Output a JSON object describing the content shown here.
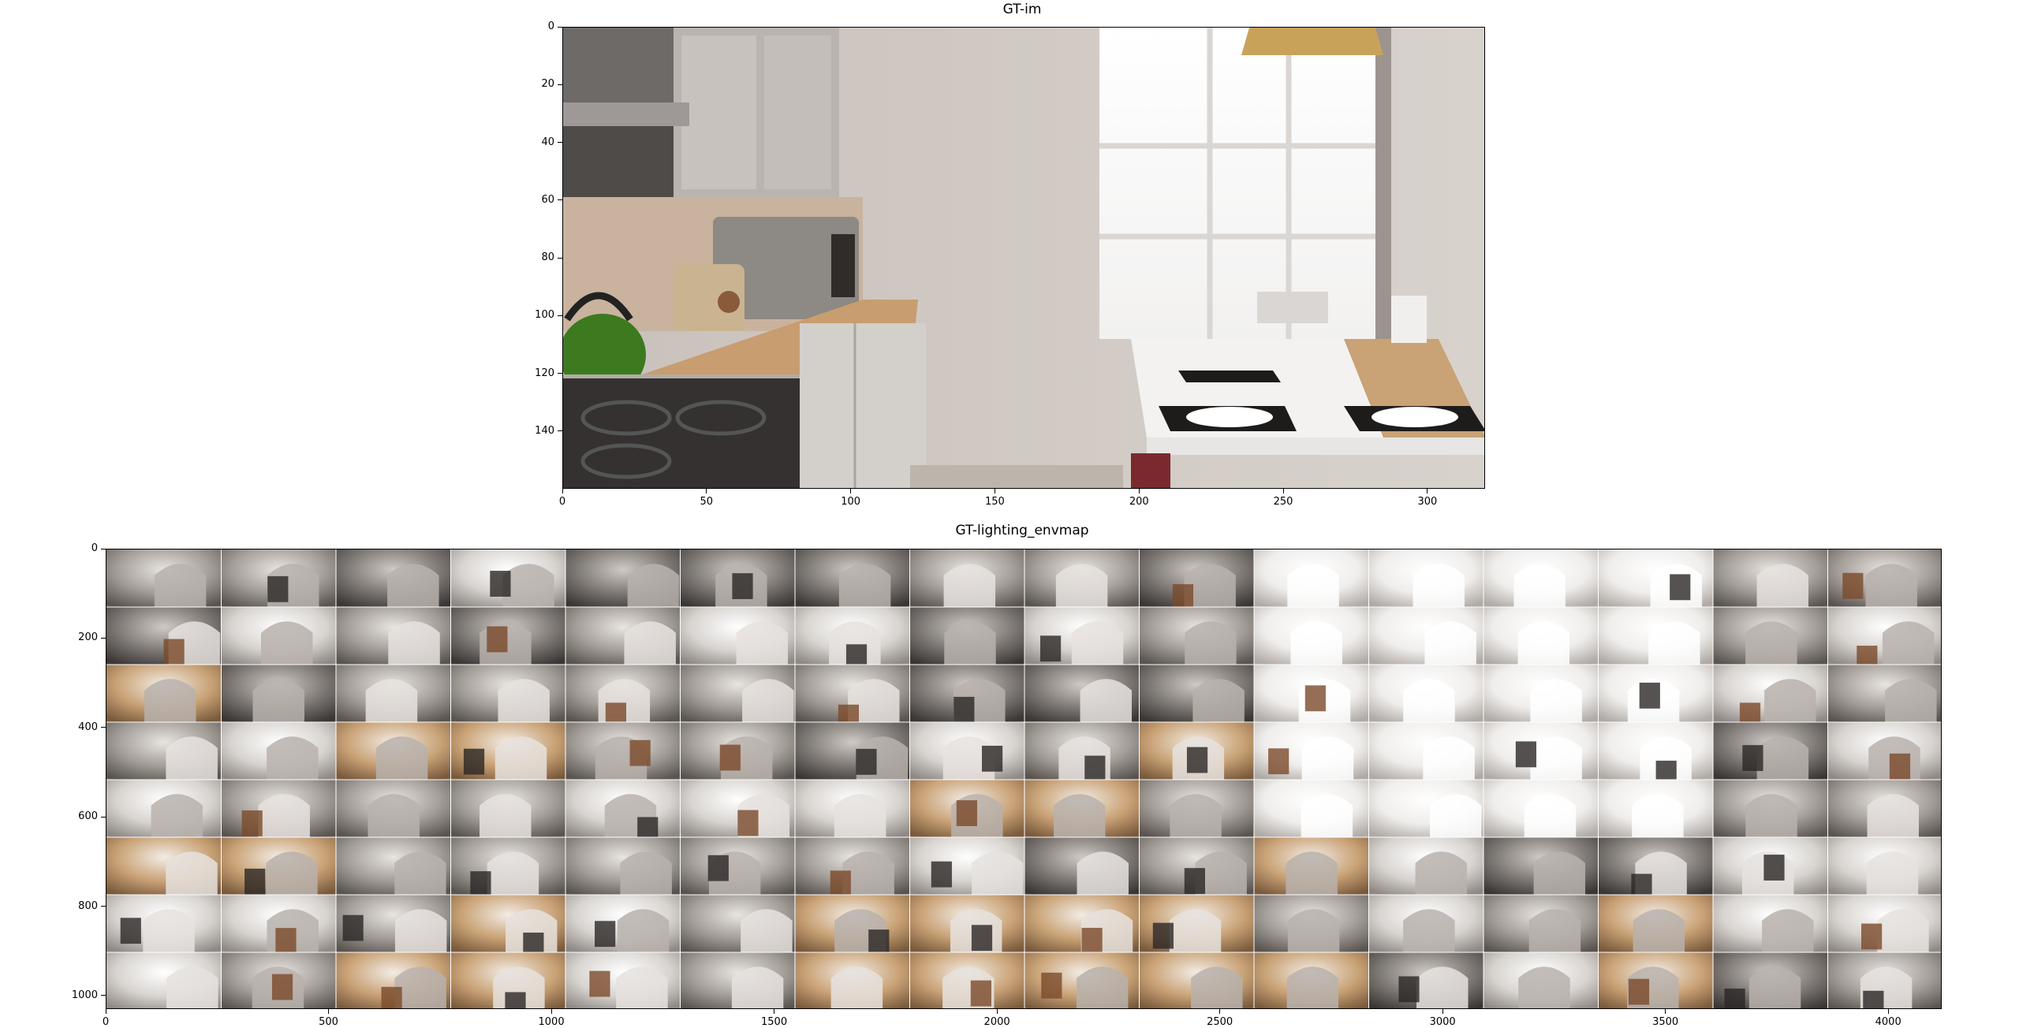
{
  "chart_data": [
    {
      "type": "image",
      "title": "GT-im",
      "xlim": [
        0,
        320
      ],
      "ylim": [
        160,
        0
      ],
      "xticks": [
        0,
        50,
        100,
        150,
        200,
        250,
        300
      ],
      "yticks": [
        0,
        20,
        40,
        60,
        80,
        100,
        120,
        140
      ],
      "xlabel": "",
      "ylabel": ""
    },
    {
      "type": "image",
      "title": "GT-lighting_envmap",
      "xlim": [
        0,
        4120
      ],
      "ylim": [
        1030,
        0
      ],
      "grid_rows": 8,
      "grid_cols": 16,
      "xticks": [
        0,
        500,
        1000,
        1500,
        2000,
        2500,
        3000,
        3500,
        4000
      ],
      "yticks": [
        0,
        200,
        400,
        600,
        800,
        1000
      ],
      "xlabel": "",
      "ylabel": ""
    }
  ]
}
